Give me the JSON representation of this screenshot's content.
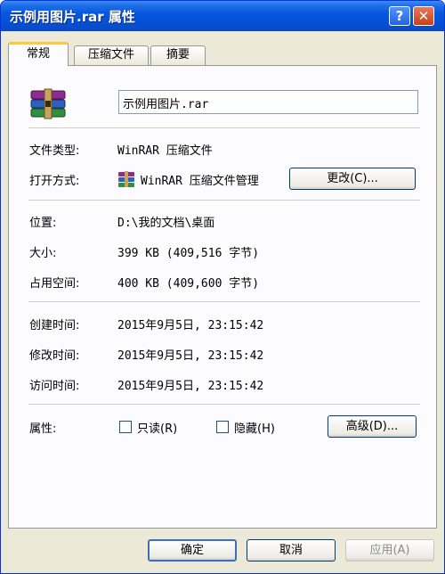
{
  "window": {
    "title": "示例用图片.rar 属性",
    "help_label": "?",
    "close_label": "✕"
  },
  "tabs": [
    {
      "label": "常规",
      "active": true
    },
    {
      "label": "压缩文件",
      "active": false
    },
    {
      "label": "摘要",
      "active": false
    }
  ],
  "general": {
    "file_icon": "winrar-archive-icon",
    "filename": "示例用图片.rar",
    "file_type_label": "文件类型:",
    "file_type_value": "WinRAR 压缩文件",
    "open_with_label": "打开方式:",
    "open_with_icon": "winrar-app-icon",
    "open_with_value": "WinRAR 压缩文件管理",
    "change_button": "更改(C)...",
    "location_label": "位置:",
    "location_value": "D:\\我的文档\\桌面",
    "size_label": "大小:",
    "size_value": "399 KB (409,516 字节)",
    "size_on_disk_label": "占用空间:",
    "size_on_disk_value": "400 KB (409,600 字节)",
    "created_label": "创建时间:",
    "created_value": "2015年9月5日, 23:15:42",
    "modified_label": "修改时间:",
    "modified_value": "2015年9月5日, 23:15:42",
    "accessed_label": "访问时间:",
    "accessed_value": "2015年9月5日, 23:15:42",
    "attributes_label": "属性:",
    "readonly_label": "只读(R)",
    "readonly_checked": false,
    "hidden_label": "隐藏(H)",
    "hidden_checked": false,
    "advanced_button": "高级(D)..."
  },
  "footer": {
    "ok_button": "确定",
    "cancel_button": "取消",
    "apply_button": "应用(A)"
  },
  "colors": {
    "titlebar": "#0450d6",
    "dialog_bg": "#ece9d8",
    "tab_highlight": "#ffc83c"
  }
}
